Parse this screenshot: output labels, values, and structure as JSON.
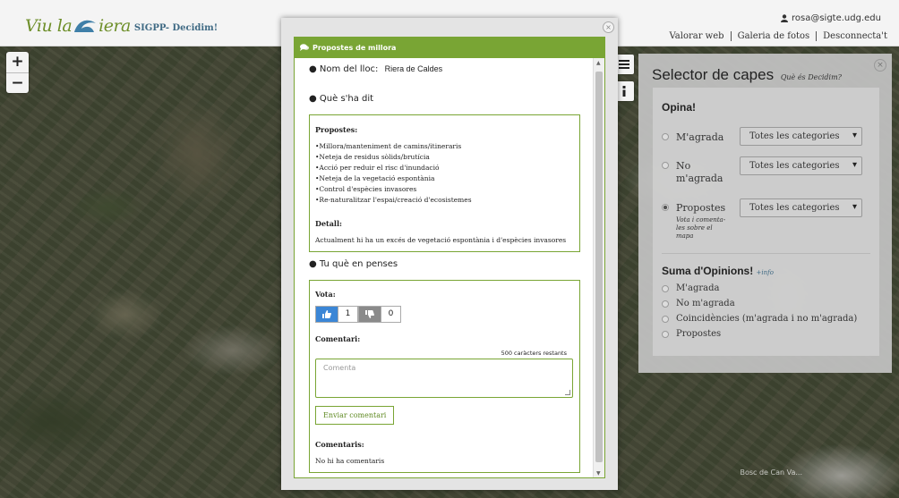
{
  "header": {
    "logo_main": "Viu la",
    "logo_end": "iera",
    "logo_sub": "SIGPP- Decidim!",
    "user_email": "rosa@sigte.udg.edu",
    "nav": [
      "Valorar web",
      "Galeria de fotos",
      "Desconnecta't"
    ]
  },
  "map": {
    "zoom_in": "+",
    "zoom_out": "−",
    "attribution": "Bosc de Can Va..."
  },
  "layers": {
    "title": "Selector de capes",
    "title_link": "Què és Decidim?",
    "close": "×",
    "opina_title": "Opina!",
    "options": [
      {
        "label": "M'agrada",
        "select": "Totes les categories",
        "checked": false
      },
      {
        "label": "No m'agrada",
        "select": "Totes les categories",
        "checked": false
      },
      {
        "label": "Propostes",
        "hint": "Vota i comenta-les sobre el mapa",
        "select": "Totes les categories",
        "checked": true
      }
    ],
    "suma_title": "Suma d'Opinions!",
    "suma_link": "+info",
    "suma_options": [
      "M'agrada",
      "No m'agrada",
      "Coincidències (m'agrada i no m'agrada)",
      "Propostes"
    ]
  },
  "modal": {
    "close": "×",
    "header": "Propostes de millora",
    "place_label": "Nom del lloc:",
    "place_value": "Riera de Caldes",
    "said_title": "Què s'ha dit",
    "proposals_label": "Propostes:",
    "proposals": [
      "•Millora/manteniment de camins/itineraris",
      "•Neteja de residus sòlids/brutícia",
      "•Acció per reduir el risc d'inundació",
      "•Neteja de la vegetació espontània",
      "•Control d'espècies invasores",
      "•Re-naturalitzar l'espai/creació d'ecosistemes"
    ],
    "detail_label": "Detall:",
    "detail_text": "Actualment hi ha un excés de vegetació espontània i d'espècies invasores",
    "think_title": "Tu què en penses",
    "vote_label": "Vota:",
    "likes": "1",
    "dislikes": "0",
    "comment_label": "Comentari:",
    "chars_left": "500 caràcters restants",
    "comment_placeholder": "Comenta",
    "send_button": "Enviar comentari",
    "comments_label": "Comentaris:",
    "no_comments": "No hi ha comentaris"
  }
}
